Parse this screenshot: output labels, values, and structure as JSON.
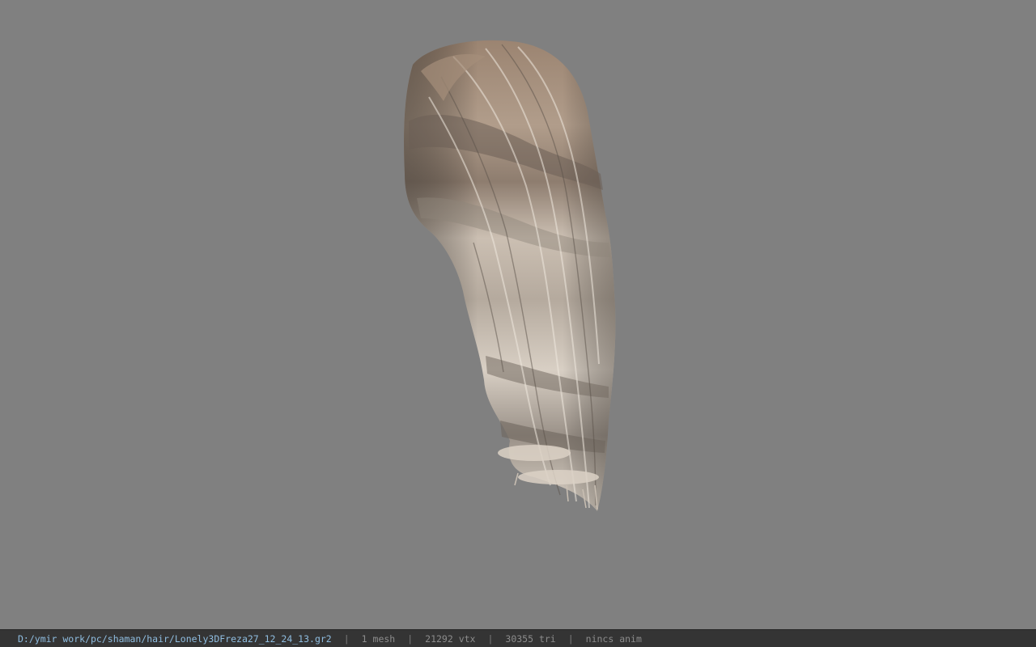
{
  "viewport": {
    "background": "#808080",
    "model_icon": "hair-mesh-icon",
    "hair_root_color": "#9b8471",
    "hair_mid_color": "#c9bcae",
    "hair_tip_color": "#ddd4c8",
    "hair_shadow_color": "#5f5750"
  },
  "status_bar": {
    "file_path": "D:/ymir work/pc/shaman/hair/Lonely3DFreza27_12_24_13.gr2",
    "separator": "|",
    "mesh_count": "1 mesh",
    "vertex_count": "21292 vtx",
    "triangle_count": "30355 tri",
    "animation": "nincs anim"
  }
}
